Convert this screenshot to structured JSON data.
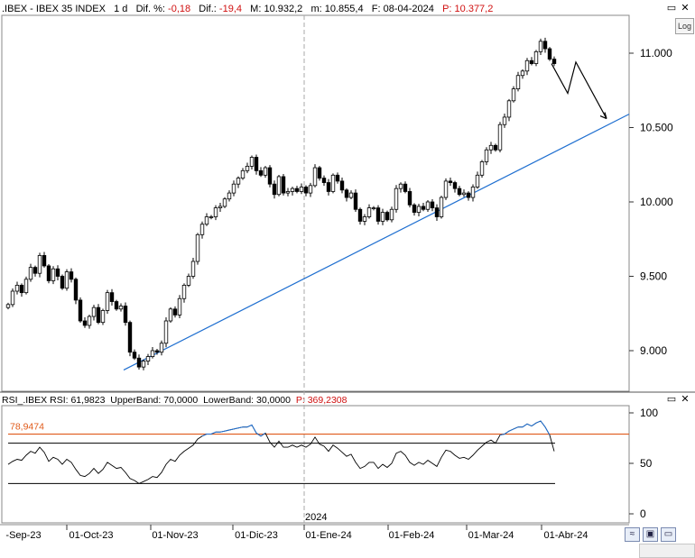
{
  "header": {
    "symbol": ".IBEX - IBEX 35 INDEX",
    "period": "1 d",
    "chg_pct_label": "Dif. %:",
    "chg_pct": "-0,18",
    "chg_label": "Dif.:",
    "chg": "-19,4",
    "high_label": "M:",
    "high": "10.932,2",
    "low_label": "m:",
    "low": "10.855,4",
    "date_label": "F:",
    "date": "08-04-2024",
    "price_label": "P:",
    "price": "10.377,2"
  },
  "log_button": "Log",
  "window_buttons": [
    "▭",
    "✕"
  ],
  "rsi_header": {
    "name": "RSI_.IBEX",
    "rsi_label": "RSI:",
    "rsi": "61,9823",
    "upper_label": "UpperBand:",
    "upper": "70,0000",
    "lower_label": "LowerBand:",
    "lower": "30,0000",
    "p_label": "P:",
    "p": "369,2308"
  },
  "rsi_level_label": "78,9474",
  "year_label": "2024",
  "colors": {
    "trendline": "#1f6fd0",
    "rsi_level": "#e05a1a",
    "rsi_overbought": "#1f6fd0",
    "red": "#d01010"
  },
  "icons": [
    "chart-settings-icon",
    "save-icon",
    "window-icon"
  ],
  "chart_data": [
    {
      "type": "candlestick",
      "title": ".IBEX - IBEX 35 INDEX",
      "x_ticks": [
        "-Sep-23",
        "01-Oct-23",
        "01-Nov-23",
        "01-Dic-23",
        "01-Ene-24",
        "01-Feb-24",
        "01-Mar-24",
        "01-Abr-24"
      ],
      "y_ticks": [
        9000,
        9500,
        10000,
        10500,
        11000
      ],
      "y_tick_labels": [
        "9.000",
        "9.500",
        "10.000",
        "10.500",
        "11.000"
      ],
      "ylim": [
        8800,
        11150
      ],
      "closes": [
        9310,
        9400,
        9440,
        9390,
        9480,
        9560,
        9520,
        9640,
        9570,
        9470,
        9550,
        9500,
        9420,
        9530,
        9480,
        9340,
        9200,
        9170,
        9230,
        9290,
        9190,
        9270,
        9390,
        9330,
        9280,
        9300,
        9190,
        8990,
        8950,
        8890,
        8930,
        8960,
        9000,
        8990,
        9050,
        9200,
        9280,
        9240,
        9350,
        9440,
        9500,
        9600,
        9780,
        9850,
        9900,
        9900,
        9960,
        9970,
        10020,
        10060,
        10120,
        10160,
        10210,
        10240,
        10300,
        10210,
        10180,
        10230,
        10120,
        10050,
        10170,
        10060,
        10070,
        10090,
        10070,
        10100,
        10060,
        10110,
        10230,
        10160,
        10130,
        10070,
        10180,
        10140,
        10080,
        10030,
        10060,
        9950,
        9870,
        9900,
        9960,
        9960,
        9870,
        9930,
        9880,
        9950,
        10090,
        10120,
        10070,
        9980,
        9930,
        9970,
        9950,
        10000,
        9960,
        9900,
        10030,
        10140,
        10130,
        10090,
        10050,
        10060,
        10030,
        10100,
        10180,
        10270,
        10350,
        10380,
        10350,
        10520,
        10570,
        10680,
        10760,
        10850,
        10880,
        10950,
        10930,
        11010,
        11080,
        11030,
        10960,
        10930
      ],
      "trendline": {
        "from": [
          "30-Oct-23",
          8870
        ],
        "to": [
          "beyond 01-Abr-24",
          10590
        ]
      },
      "projection": [
        10930,
        10730,
        10940,
        10560
      ]
    },
    {
      "type": "line",
      "title": "RSI_.IBEX",
      "y_ticks": [
        0,
        50,
        100
      ],
      "ylim": [
        -5,
        105
      ],
      "upper_band": 70,
      "lower_band": 30,
      "level": 78.9474,
      "values": [
        49,
        52,
        54,
        53,
        58,
        62,
        60,
        66,
        61,
        52,
        56,
        54,
        49,
        54,
        51,
        44,
        38,
        37,
        40,
        45,
        40,
        44,
        51,
        48,
        45,
        46,
        41,
        35,
        33,
        30,
        32,
        34,
        37,
        36,
        41,
        49,
        54,
        52,
        58,
        62,
        65,
        68,
        74,
        77,
        79,
        79,
        81,
        81,
        82,
        83,
        84,
        85,
        86,
        86,
        88,
        80,
        77,
        80,
        71,
        66,
        72,
        66,
        66,
        68,
        66,
        68,
        66,
        69,
        76,
        69,
        67,
        62,
        68,
        65,
        61,
        57,
        59,
        51,
        45,
        47,
        51,
        51,
        45,
        49,
        46,
        50,
        60,
        62,
        58,
        51,
        48,
        51,
        49,
        53,
        50,
        47,
        56,
        63,
        62,
        58,
        55,
        56,
        54,
        58,
        63,
        67,
        71,
        73,
        70,
        78,
        79,
        82,
        84,
        86,
        86,
        89,
        87,
        90,
        92,
        86,
        78,
        62
      ]
    }
  ]
}
